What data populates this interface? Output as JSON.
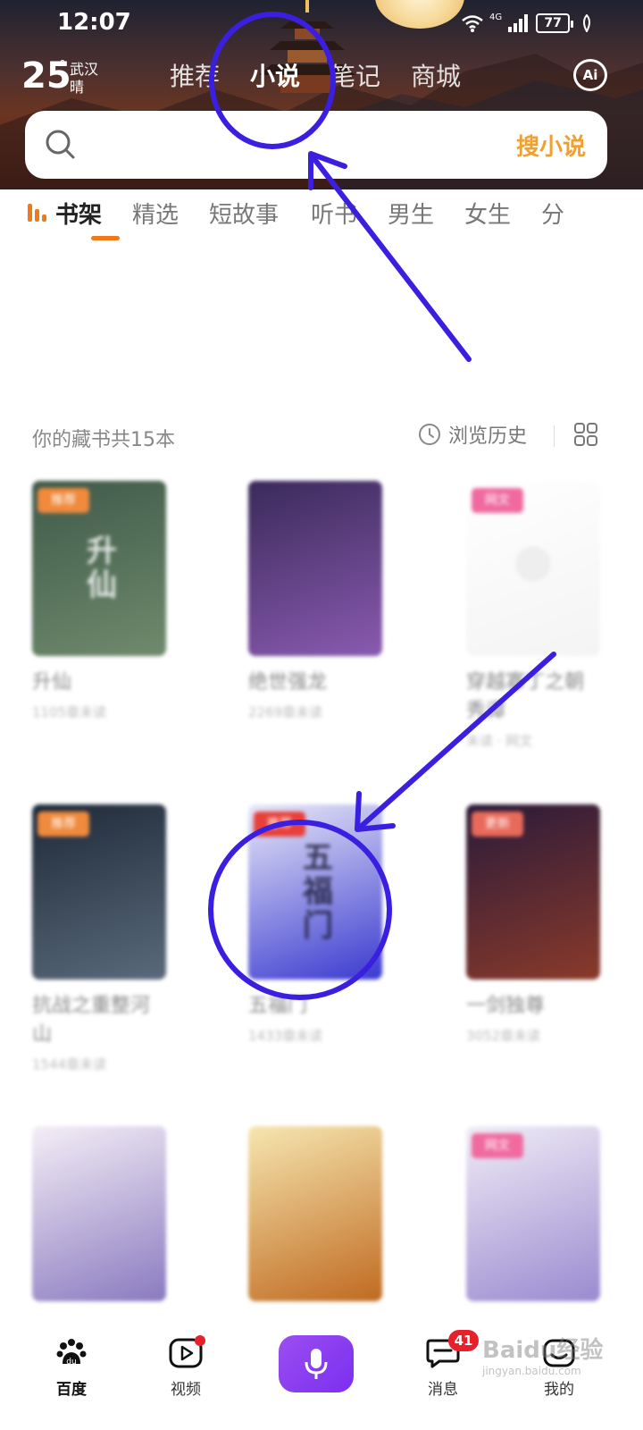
{
  "status_bar": {
    "time": "12:07",
    "network": "4G",
    "battery": "77"
  },
  "weather": {
    "temperature": "25",
    "degree_symbol": "°",
    "city": "武汉",
    "condition": "晴"
  },
  "top_tabs": [
    {
      "label": "推荐",
      "active": false
    },
    {
      "label": "小说",
      "active": true
    },
    {
      "label": "笔记",
      "active": false
    },
    {
      "label": "商城",
      "active": false
    }
  ],
  "ai_button": "Ai",
  "search": {
    "placeholder": "",
    "button_label": "搜小说"
  },
  "category_tabs": [
    {
      "label": "书架",
      "active": true
    },
    {
      "label": "精选",
      "active": false
    },
    {
      "label": "短故事",
      "active": false
    },
    {
      "label": "听书",
      "active": false
    },
    {
      "label": "男生",
      "active": false
    },
    {
      "label": "女生",
      "active": false
    },
    {
      "label": "分",
      "active": false
    }
  ],
  "shelf": {
    "count_text": "你的藏书共15本",
    "history_label": "浏览历史"
  },
  "books": [
    {
      "title": "升仙",
      "progress": "1105章未读",
      "badge": "推荐",
      "badge_color": "#f08a3c",
      "cover_text": "升仙",
      "cover_colors": [
        "#3f5a4a",
        "#6f8a6c"
      ]
    },
    {
      "title": "绝世强龙",
      "progress": "2269章未读",
      "badge": "",
      "badge_color": "",
      "cover_text": "",
      "cover_colors": [
        "#3a2a5a",
        "#8a5ab0"
      ]
    },
    {
      "title": "穿越寡丁之朝秀谭",
      "progress": "未读 · 网文",
      "badge": "网文",
      "badge_color": "#f06aa0",
      "cover_text": "",
      "cover_colors": [
        "#ffffff",
        "#f4f4f4"
      ]
    },
    {
      "title": "抗战之重整河山",
      "progress": "1544章未读",
      "badge": "推荐",
      "badge_color": "#f08a3c",
      "cover_text": "",
      "cover_colors": [
        "#1f2a3a",
        "#5a6a7a"
      ]
    },
    {
      "title": "五福门",
      "progress": "1433章未读",
      "badge": "推荐",
      "badge_color": "#e8403a",
      "cover_text": "五福门",
      "cover_colors": [
        "#e8e8f8",
        "#3a3ad0"
      ]
    },
    {
      "title": "一剑独尊",
      "progress": "3052章未读",
      "badge": "更新",
      "badge_color": "#e86a5a",
      "cover_text": "",
      "cover_colors": [
        "#2a1a3a",
        "#8a3a2a"
      ]
    },
    {
      "title": "",
      "progress": "",
      "badge": "",
      "badge_color": "",
      "cover_text": "",
      "cover_colors": [
        "#f4eef6",
        "#8a7ac0"
      ]
    },
    {
      "title": "",
      "progress": "",
      "badge": "",
      "badge_color": "",
      "cover_text": "",
      "cover_colors": [
        "#f6e6b0",
        "#c06a20"
      ]
    },
    {
      "title": "",
      "progress": "",
      "badge": "网文",
      "badge_color": "#f06aa0",
      "cover_text": "",
      "cover_colors": [
        "#f0ecf6",
        "#9a8ad0"
      ]
    }
  ],
  "bottom_nav": [
    {
      "label": "百度",
      "active": true,
      "icon": "baidu-paw-icon"
    },
    {
      "label": "视频",
      "active": false,
      "icon": "video-play-icon"
    },
    {
      "label": "",
      "active": false,
      "icon": "microphone-icon"
    },
    {
      "label": "消息",
      "active": false,
      "icon": "message-bubble-icon",
      "count": "41"
    },
    {
      "label": "我的",
      "active": false,
      "icon": "profile-icon"
    }
  ],
  "watermark": {
    "text": "Baidu经验",
    "sub": "jingyan.baidu.com"
  },
  "colors": {
    "accent_orange": "#f07a1a",
    "search_button": "#f0a030",
    "annotation_blue": "#3a1fe0",
    "mic_purple": "#8a3ff0",
    "notification_red": "#e8202a"
  }
}
